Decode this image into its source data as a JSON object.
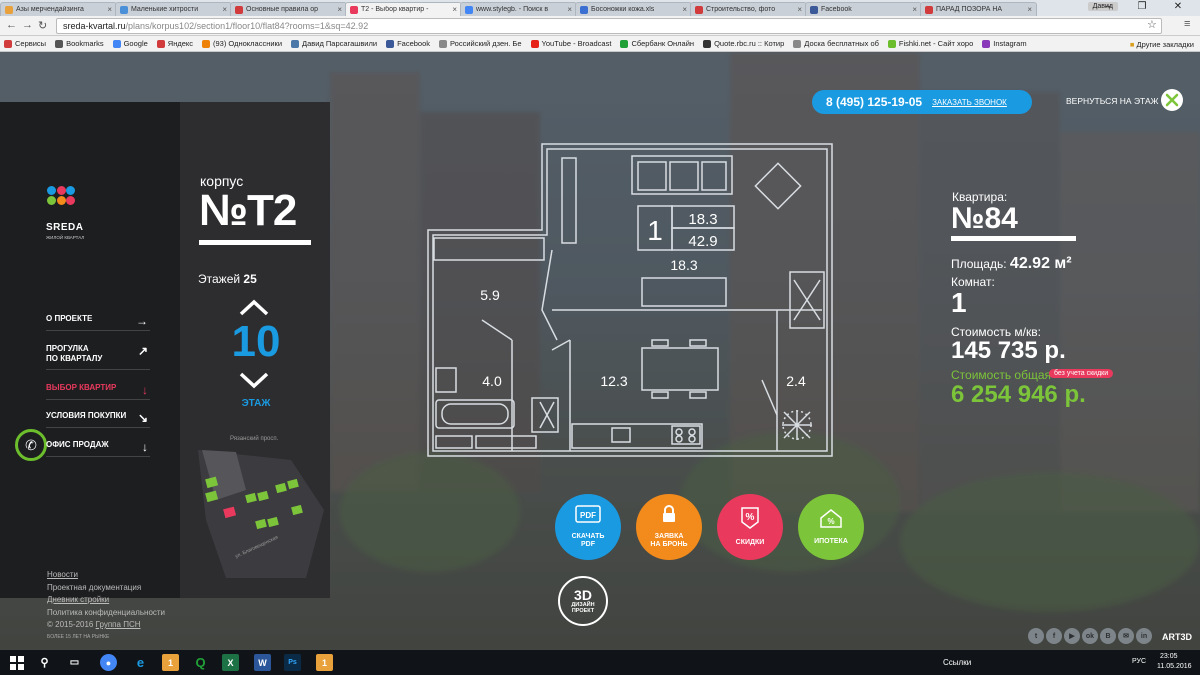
{
  "browser": {
    "tabs": [
      {
        "title": "Азы мерчендайзинга",
        "color": "#e9a13b",
        "active": false
      },
      {
        "title": "Маленькие хитрости",
        "color": "#4a90d9",
        "active": false
      },
      {
        "title": "Основные правила ор",
        "color": "#d13b3b",
        "active": false
      },
      {
        "title": "T2 - Выбор квартир -",
        "color": "#e9395d",
        "active": true
      },
      {
        "title": "www.stylegb. - Поиск в",
        "color": "#4285f4",
        "active": false
      },
      {
        "title": "Босоножки кожа.xls",
        "color": "#3b6fd1",
        "active": false
      },
      {
        "title": "Строительство, фото",
        "color": "#d13b3b",
        "active": false
      },
      {
        "title": "Facebook",
        "color": "#3b5998",
        "active": false
      },
      {
        "title": "ПАРАД ПОЗОРА НА",
        "color": "#d13b3b",
        "active": false
      }
    ],
    "user_badge": "Давид",
    "url_domain": "sreda-kvartal.ru",
    "url_path": "/plans/korpus102/section1/floor10/flat84?rooms=1&sq=42.92",
    "bookmarks": [
      {
        "label": "Сервисы",
        "color": "#d13b3b"
      },
      {
        "label": "Bookmarks",
        "color": "#555555"
      },
      {
        "label": "Google",
        "color": "#4285f4"
      },
      {
        "label": "Яндекс",
        "color": "#d13b3b"
      },
      {
        "label": "(93) Одноклассники",
        "color": "#ee8208"
      },
      {
        "label": "Давид Парсагашвили",
        "color": "#4a76a8"
      },
      {
        "label": "Facebook",
        "color": "#3b5998"
      },
      {
        "label": "Российский дзен. Бе",
        "color": "#888888"
      },
      {
        "label": "YouTube - Broadcast",
        "color": "#e62117"
      },
      {
        "label": "Сбербанк Онлайн",
        "color": "#21a038"
      },
      {
        "label": "Quote.rbc.ru :: Котир",
        "color": "#333333"
      },
      {
        "label": "Доска бесплатных об",
        "color": "#888888"
      },
      {
        "label": "Fishki.net - Сайт хоро",
        "color": "#6cbe2c"
      },
      {
        "label": "Instagram",
        "color": "#8a3ab9"
      }
    ],
    "other_bookmarks": "Другие закладки"
  },
  "header": {
    "phone": "8 (495) 125-19-05",
    "callback": "ЗАКАЗАТЬ ЗВОНОК",
    "back": "ВЕРНУТЬСЯ НА ЭТАЖ"
  },
  "logo": {
    "name": "SREDA",
    "sub": "ЖИЛОЙ КВАРТАЛ"
  },
  "menu": [
    {
      "label": "О ПРОЕКТЕ",
      "arrow": "→",
      "active": false
    },
    {
      "label": "ПРОГУЛКА\nПО КВАРТАЛУ",
      "arrow": "↗",
      "active": false
    },
    {
      "label": "ВЫБОР КВАРТИР",
      "arrow": "↓",
      "active": true
    },
    {
      "label": "УСЛОВИЯ ПОКУПКИ",
      "arrow": "↘",
      "active": false
    },
    {
      "label": "ОФИС ПРОДАЖ",
      "arrow": "↓",
      "active": false
    }
  ],
  "footer": {
    "links": [
      {
        "label": "Новости",
        "underline": true
      },
      {
        "label": "Проектная документация",
        "underline": false
      },
      {
        "label": "Дневник стройки",
        "underline": true
      },
      {
        "label": "Политика конфиденциальности",
        "underline": false
      }
    ],
    "copyright_prefix": "© 2015-2016",
    "copyright_link": "Группа ПСН",
    "small": "БОЛЕЕ 15 ЛЕТ НА РЫНКЕ"
  },
  "building": {
    "label": "корпус",
    "number": "№Т2",
    "floors_label": "Этажей",
    "floors_value": "25",
    "current_floor": "10",
    "floor_label": "ЭТАЖ",
    "map_street_top": "Рязанский просп.",
    "map_street_bottom": "ул. Благовещенская"
  },
  "plan": {
    "rooms_count": "1",
    "living_area": "18.3",
    "total_area": "42.9",
    "areas": [
      "5.9",
      "18.3",
      "4.0",
      "12.3",
      "2.4"
    ]
  },
  "apartment": {
    "label": "Квартира:",
    "number": "№84",
    "area_label": "Площадь:",
    "area_value": "42.92 м²",
    "rooms_label": "Комнат:",
    "rooms_value": "1",
    "ppm_label": "Стоимость м/кв:",
    "ppm_value": "145 735 р.",
    "total_label": "Стоимость общая",
    "discount_badge": "без учета скидки",
    "total_value": "6 254 946 р."
  },
  "actions": [
    {
      "label": "СКАЧАТЬ\nPDF",
      "icon": "PDF",
      "color": "#1a9ae1"
    },
    {
      "label": "ЗАЯВКА\nНА БРОНЬ",
      "icon": "lock",
      "color": "#f28a1c"
    },
    {
      "label": "СКИДКИ",
      "icon": "%",
      "color": "#e9395d"
    },
    {
      "label": "ИПОТЕКА",
      "icon": "house-%",
      "color": "#7cc43a"
    }
  ],
  "design3d": {
    "big": "3D",
    "small": "ДИЗАЙН\nПРОЕКТ"
  },
  "social": [
    "t",
    "f",
    "▶",
    "ok",
    "В",
    "✉",
    "in"
  ],
  "brand": "ART3D",
  "taskbar": {
    "links": "Ссылки",
    "lang": "РУС",
    "time": "23:05",
    "date": "11.05.2016"
  }
}
